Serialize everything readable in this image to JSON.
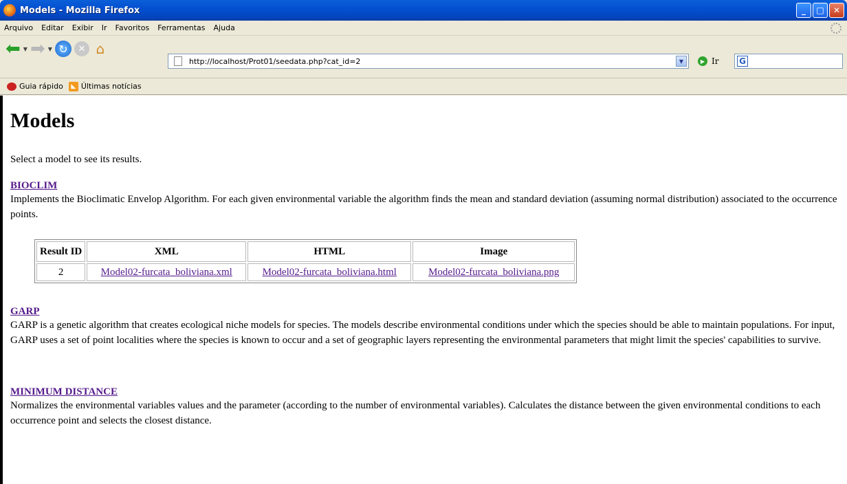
{
  "window": {
    "title": "Models - Mozilla Firefox",
    "buttons": {
      "minimize": "_",
      "maximize": "□",
      "close": "✕"
    }
  },
  "menu": {
    "items": [
      "Arquivo",
      "Editar",
      "Exibir",
      "Ir",
      "Favoritos",
      "Ferramentas",
      "Ajuda"
    ]
  },
  "toolbar": {
    "url": "http://localhost/Prot01/seedata.php?cat_id=2",
    "go_label": "Ir",
    "search_value": ""
  },
  "bookmarks": {
    "items": [
      "Guia rápido",
      "Últimas notícias"
    ]
  },
  "page": {
    "title": "Models",
    "intro": "Select a model to see its results.",
    "models": [
      {
        "name": "BIOCLIM",
        "description": "Implements the Bioclimatic Envelop Algorithm. For each given environmental variable the algorithm finds the mean and standard deviation (assuming normal distribution) associated to the occurrence points."
      },
      {
        "name": "GARP",
        "description": "GARP is a genetic algorithm that creates ecological niche models for species. The models describe environmental conditions under which the species should be able to maintain populations. For input, GARP uses a set of point localities where the species is known to occur and a set of geographic layers representing the environmental parameters that might limit the species' capabilities to survive."
      },
      {
        "name": "MINIMUM DISTANCE",
        "description": "Normalizes the environmental variables values and the parameter (according to the number of environmental variables). Calculates the distance between the given environmental conditions to each occurrence point and selects the closest distance."
      }
    ],
    "results_table": {
      "headers": [
        "Result ID",
        "XML",
        "HTML",
        "Image"
      ],
      "rows": [
        [
          "2",
          "Model02-furcata_boliviana.xml",
          "Model02-furcata_boliviana.html",
          "Model02-furcata_boliviana.png"
        ]
      ]
    }
  }
}
